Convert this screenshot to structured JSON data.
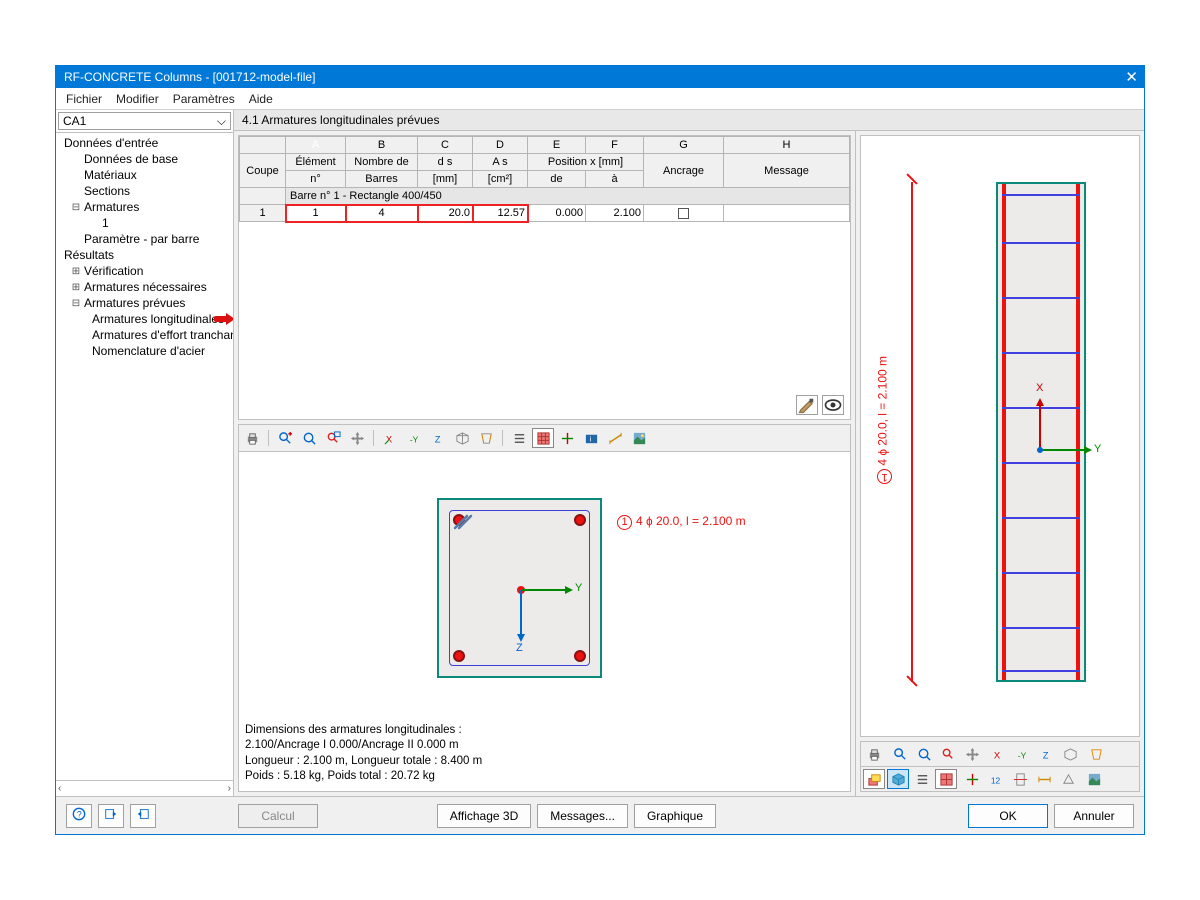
{
  "window": {
    "title": "RF-CONCRETE Columns - [001712-model-file]",
    "close": "✕"
  },
  "menubar": [
    "Fichier",
    "Modifier",
    "Paramètres",
    "Aide"
  ],
  "nav": {
    "combo": "CA1",
    "tree": {
      "input_title": "Données d'entrée",
      "items_input": [
        "Données de base",
        "Matériaux",
        "Sections"
      ],
      "arm": "Armatures",
      "arm_items": [
        "1"
      ],
      "param": "Paramètre - par barre",
      "results_title": "Résultats",
      "verif": "Vérification",
      "arm_nec": "Armatures nécessaires",
      "arm_prev": "Armatures prévues",
      "arm_prev_items": [
        "Armatures longitudinales",
        "Armatures d'effort tranchant",
        "Nomenclature d'acier"
      ]
    }
  },
  "panel": {
    "title": "4.1 Armatures longitudinales prévues"
  },
  "table": {
    "letters": [
      "",
      "A",
      "B",
      "C",
      "D",
      "E",
      "F",
      "G",
      "H"
    ],
    "head1": [
      "Coupe",
      "Élément",
      "Nombre de",
      "d s",
      "A s",
      "Position x [mm]",
      "",
      "",
      ""
    ],
    "head2": [
      "",
      "n°",
      "Barres",
      "[mm]",
      "[cm²]",
      "de",
      "à",
      "Ancrage",
      "Message"
    ],
    "group": "Barre n° 1 - Rectangle 400/450",
    "row": {
      "coupe": "1",
      "elem": "1",
      "nbar": "4",
      "ds": "20.0",
      "as": "12.57",
      "de": "0.000",
      "a": "2.100"
    }
  },
  "viewer": {
    "annotation": "4 ɸ 20.0, l = 2.100 m",
    "annotation_num": "1",
    "axis_y": "Y",
    "axis_z": "Z",
    "axis_x": "X",
    "text_lines": [
      "Dimensions des armatures longitudinales :",
      "2.100/Ancrage I 0.000/Ancrage II 0.000 m",
      "Longueur : 2.100 m, Longueur totale : 8.400 m",
      "Poids : 5.18 kg, Poids total : 20.72 kg"
    ]
  },
  "right_viewer": {
    "annotation": "4 ɸ 20.0, l = 2.100 m",
    "annotation_num": "1"
  },
  "bottom": {
    "calcul": "Calcul",
    "aff3d": "Affichage 3D",
    "messages": "Messages...",
    "graphique": "Graphique",
    "ok": "OK",
    "annuler": "Annuler"
  }
}
